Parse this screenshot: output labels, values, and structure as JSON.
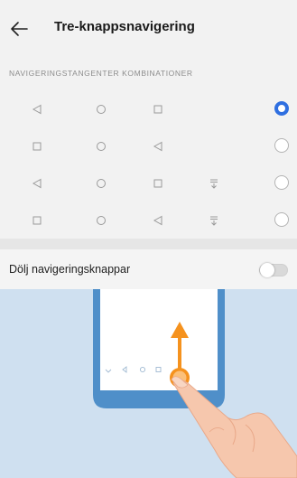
{
  "header": {
    "title": "Tre-knappsnavigering",
    "back_icon": "arrow-left-icon"
  },
  "section": {
    "title": "NAVIGERINGSTANGENTER KOMBINATIONER"
  },
  "combinations": [
    {
      "icons": [
        "triangle-left-icon",
        "circle-icon",
        "square-icon"
      ],
      "selected": true
    },
    {
      "icons": [
        "square-icon",
        "circle-icon",
        "triangle-left-icon"
      ],
      "selected": false
    },
    {
      "icons": [
        "triangle-left-icon",
        "circle-icon",
        "square-icon",
        "notification-pull-icon"
      ],
      "selected": false
    },
    {
      "icons": [
        "square-icon",
        "circle-icon",
        "triangle-left-icon",
        "notification-pull-icon"
      ],
      "selected": false
    }
  ],
  "hide_nav": {
    "label": "Dölj navigeringsknappar",
    "enabled": false
  },
  "colors": {
    "accent": "#2f6fe0",
    "illustration_bg": "#cfe0f0",
    "arrow": "#f5921e",
    "phone_frame": "#4f8fc9"
  }
}
